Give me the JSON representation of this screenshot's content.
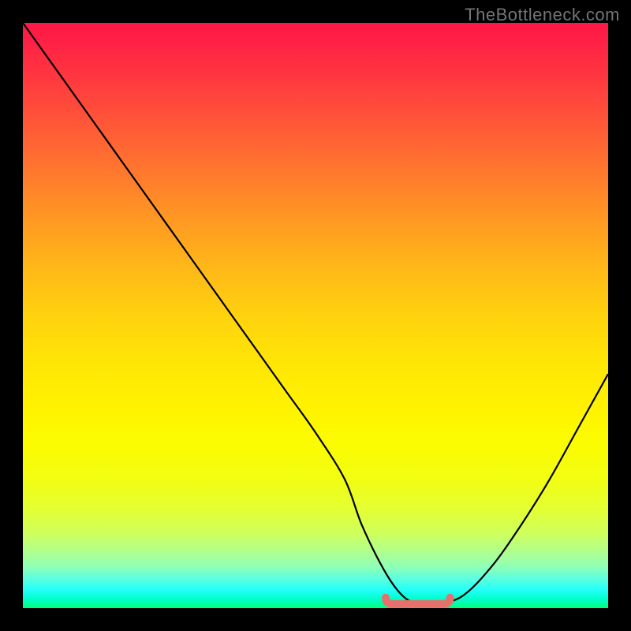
{
  "watermark": "TheBottleneck.com",
  "chart_data": {
    "type": "line",
    "title": "",
    "xlabel": "",
    "ylabel": "",
    "xlim": [
      0,
      100
    ],
    "ylim": [
      0,
      100
    ],
    "series": [
      {
        "name": "bottleneck-curve",
        "x": [
          0,
          5,
          10,
          15,
          20,
          25,
          30,
          35,
          40,
          45,
          50,
          55,
          58,
          62,
          65,
          68,
          70,
          75,
          80,
          85,
          90,
          95,
          100
        ],
        "y": [
          100,
          93,
          86,
          79,
          72,
          65,
          58,
          51,
          44,
          37,
          30,
          22,
          14,
          6,
          2,
          0.5,
          0.5,
          2,
          7,
          14,
          22,
          31,
          40
        ]
      }
    ],
    "marker": {
      "name": "optimal-range",
      "x_start": 62,
      "x_end": 73,
      "y": 0.7,
      "color": "#e5716a"
    },
    "gradient": {
      "top": "#ff1846",
      "mid": "#fff300",
      "bottom": "#00ff75"
    }
  }
}
